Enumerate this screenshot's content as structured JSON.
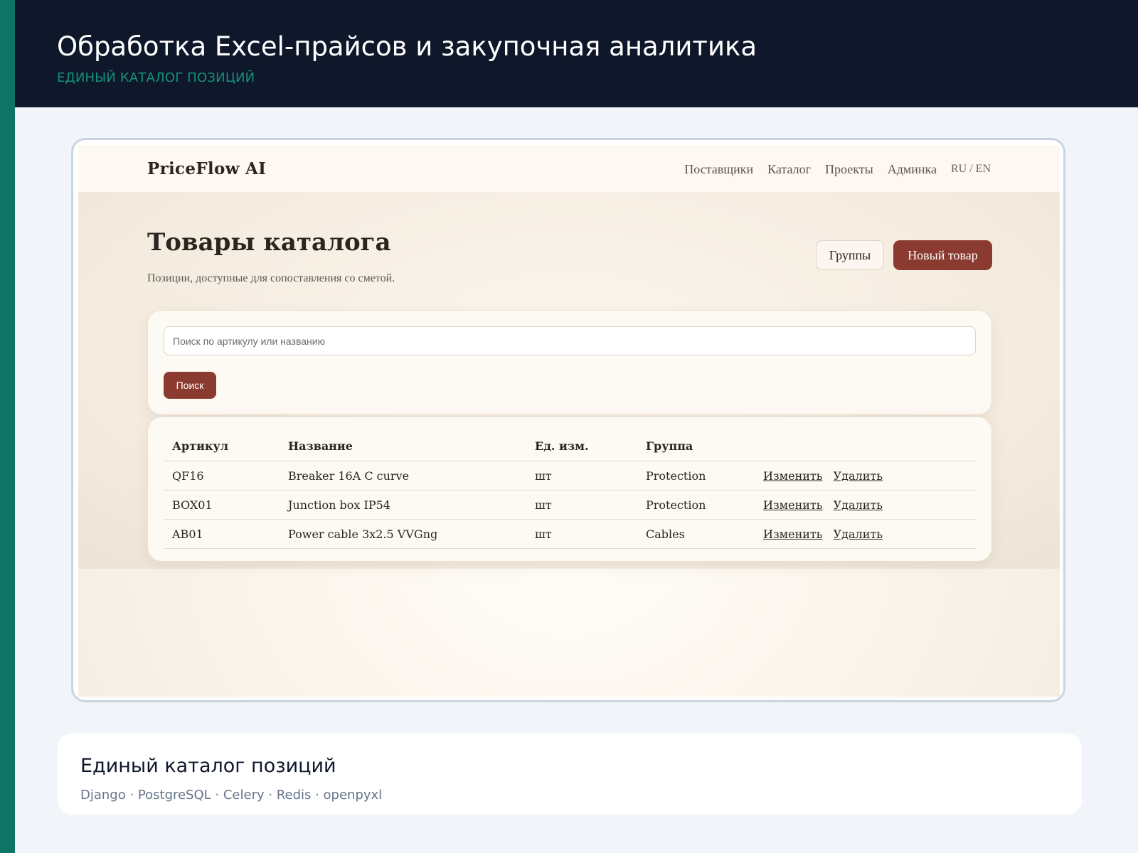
{
  "banner": {
    "title": "Обработка Excel-прайсов и закупочная аналитика",
    "subtitle": "ЕДИНЫЙ КАТАЛОГ ПОЗИЦИЙ"
  },
  "app": {
    "brand": "PriceFlow AI",
    "nav": [
      "Поставщики",
      "Каталог",
      "Проекты",
      "Админка"
    ],
    "lang": "RU / EN",
    "page_title": "Товары каталога",
    "page_description": "Позиции, доступные для сопоставления со сметой.",
    "groups_button": "Группы",
    "new_button": "Новый товар",
    "search": {
      "placeholder": "Поиск по артикулу или названию",
      "value": "",
      "button": "Поиск"
    },
    "table": {
      "headers": [
        "Артикул",
        "Название",
        "Ед. изм.",
        "Группа",
        ""
      ],
      "rows": [
        {
          "sku": "QF16",
          "name": "Breaker 16A C curve",
          "unit": "шт",
          "group": "Protection"
        },
        {
          "sku": "BOX01",
          "name": "Junction box IP54",
          "unit": "шт",
          "group": "Protection"
        },
        {
          "sku": "AB01",
          "name": "Power cable 3x2.5 VVGng",
          "unit": "шт",
          "group": "Cables"
        }
      ],
      "edit_label": "Изменить",
      "delete_label": "Удалить"
    }
  },
  "info": {
    "title": "Единый каталог позиций",
    "tech": "Django · PostgreSQL · Celery · Redis · openpyxl"
  },
  "colors": {
    "accent": "#0e7566",
    "banner_bg": "#0f172a",
    "primary_button": "#8b3a2f",
    "page_bg": "#f1f4f8"
  }
}
